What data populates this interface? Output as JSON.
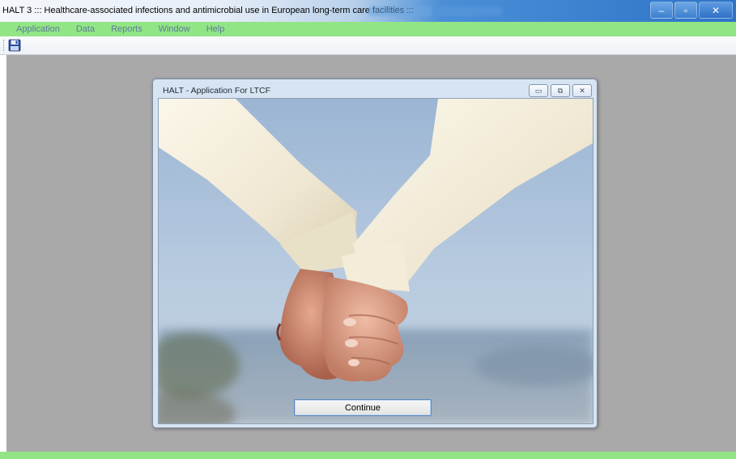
{
  "window": {
    "title": "HALT 3 ::: Healthcare-associated infections and antimicrobial use in European long-term care facilities :::",
    "controls": {
      "minimize": "‒",
      "maximize": "▫",
      "close": "✕"
    }
  },
  "menu": {
    "items": [
      "Application",
      "Data",
      "Reports",
      "Window",
      "Help"
    ]
  },
  "toolbar": {
    "icons": [
      "save-icon"
    ]
  },
  "child_window": {
    "title": "HALT - Application For LTCF",
    "controls": {
      "minimize": "▭",
      "restore": "⧉",
      "close": "✕"
    },
    "continue_label": "Continue"
  },
  "colors": {
    "menu_bar": "#92e585",
    "mdi_background": "#a9a9a9",
    "title_bar_accent": "#2f74c8"
  }
}
